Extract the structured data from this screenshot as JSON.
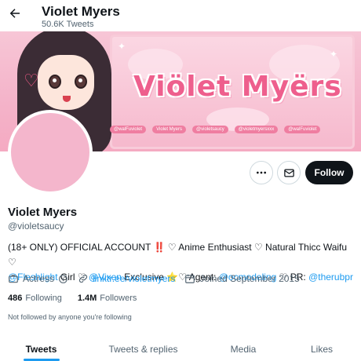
{
  "header": {
    "name": "Violet Myers",
    "tweet_count": "50.6K Tweets"
  },
  "banner": {
    "title": "Viölet Myërs",
    "socials": [
      "@walFuviolet",
      "Violet Myers",
      "@violetsaucy",
      "@violetmyersxxx",
      "@walFuviolet"
    ]
  },
  "profile": {
    "name": "Violet Myers",
    "handle": "@violetsaucy",
    "bio": {
      "part1": "(18+ ONLY) OFFICIAL ACCOUNT",
      "bangs": "‼️",
      "part2": " ♡ Anime Enthusiast ♡ Natural Thicc Waifu ♡",
      "link1": "@Fleshlight",
      "part3": " Girl ♡ ",
      "link2": "@Vixen",
      "part4": " Exclusive ",
      "star": "⭐",
      "part5": "♡ Agent: ",
      "link3": "@ocmodeling",
      "part6": " ♡ PR: ",
      "link4": "@therubpr"
    },
    "category": "Actress",
    "website": "linktr.ee/violetmyers",
    "joined": "Joined September 2015",
    "following_count": "486",
    "following_label": "Following",
    "followers_count": "1.4M",
    "followers_label": "Followers",
    "note": "Not followed by anyone you're following"
  },
  "actions": {
    "follow_label": "Follow"
  },
  "tabs": [
    {
      "label": "Tweets",
      "active": true
    },
    {
      "label": "Tweets & replies",
      "active": false
    },
    {
      "label": "Media",
      "active": false
    },
    {
      "label": "Likes",
      "active": false
    }
  ],
  "colors": {
    "accent": "#1d9bf0",
    "text": "#0f1419",
    "muted": "#536471",
    "banner_pink": "#f4b3c9",
    "avatar_pink": "#f4b6cc"
  }
}
